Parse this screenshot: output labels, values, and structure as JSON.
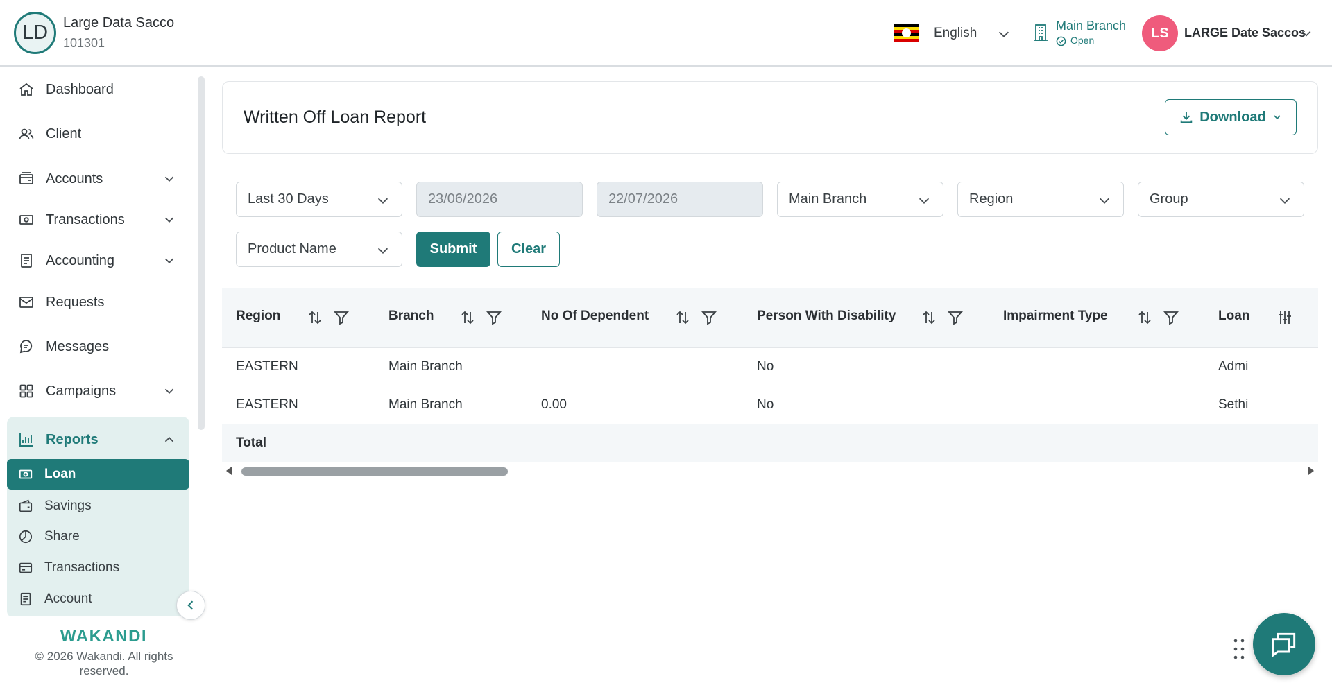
{
  "org": {
    "initials": "LD",
    "name": "Large Data Sacco",
    "code": "101301"
  },
  "header": {
    "language": "English",
    "branch": {
      "name": "Main Branch",
      "status": "Open"
    },
    "user": {
      "initials": "LS",
      "name": "LARGE Date Saccos"
    }
  },
  "sidebar": {
    "items": [
      {
        "label": "Dashboard",
        "icon": "home-icon"
      },
      {
        "label": "Client",
        "icon": "users-icon"
      },
      {
        "label": "Accounts",
        "icon": "wallet-icon"
      },
      {
        "label": "Transactions",
        "icon": "cash-icon"
      },
      {
        "label": "Accounting",
        "icon": "ledger-icon"
      },
      {
        "label": "Requests",
        "icon": "mail-icon"
      },
      {
        "label": "Messages",
        "icon": "chat-icon"
      },
      {
        "label": "Campaigns",
        "icon": "grid-icon"
      }
    ],
    "reports": {
      "label": "Reports",
      "sub_items": [
        {
          "label": "Loan",
          "active": true
        },
        {
          "label": "Savings"
        },
        {
          "label": "Share"
        },
        {
          "label": "Transactions"
        },
        {
          "label": "Account"
        }
      ]
    },
    "footer": {
      "brand": "WAKANDI",
      "copyright": "© 2026 Wakandi. All rights reserved."
    }
  },
  "page": {
    "title": "Written Off Loan Report",
    "download_label": "Download"
  },
  "filters": {
    "period": "Last 30 Days",
    "date_from": "23/06/2026",
    "date_to": "22/07/2026",
    "branch": "Main Branch",
    "region": "Region",
    "group": "Group",
    "product": "Product Name",
    "submit_label": "Submit",
    "clear_label": "Clear"
  },
  "table": {
    "columns": [
      "Region",
      "Branch",
      "No Of Dependent",
      "Person With Disability",
      "Impairment Type",
      "Loan"
    ],
    "rows": [
      [
        "EASTERN",
        "Main Branch",
        "",
        "No",
        "",
        "Admi"
      ],
      [
        "EASTERN",
        "Main Branch",
        "0.00",
        "No",
        "",
        "Sethi"
      ]
    ],
    "total_label": "Total"
  },
  "colors": {
    "accent": "#1f7a78",
    "avatar": "#ef5b7c",
    "reports_bg": "#e3f0ef"
  }
}
